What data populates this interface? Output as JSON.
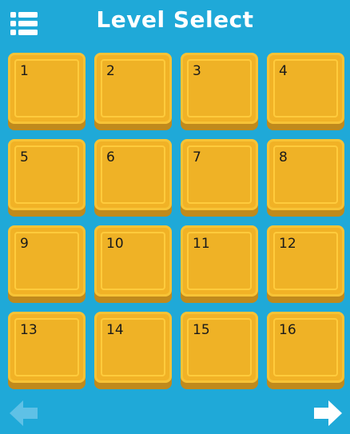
{
  "header": {
    "title": "Level Select",
    "menu_icon": "list-menu-icon"
  },
  "levels": [
    {
      "number": "1"
    },
    {
      "number": "2"
    },
    {
      "number": "3"
    },
    {
      "number": "4"
    },
    {
      "number": "5"
    },
    {
      "number": "6"
    },
    {
      "number": "7"
    },
    {
      "number": "8"
    },
    {
      "number": "9"
    },
    {
      "number": "10"
    },
    {
      "number": "11"
    },
    {
      "number": "12"
    },
    {
      "number": "13"
    },
    {
      "number": "14"
    },
    {
      "number": "15"
    },
    {
      "number": "16"
    }
  ],
  "navigation": {
    "prev_icon": "arrow-left-icon",
    "prev_enabled": false,
    "next_icon": "arrow-right-icon",
    "next_enabled": true
  },
  "colors": {
    "background": "#1fa9d8",
    "tile": "#f1b226",
    "tile_shadow": "#c08a1c",
    "title": "#ffffff",
    "arrow_disabled": "#5fc1e6"
  }
}
